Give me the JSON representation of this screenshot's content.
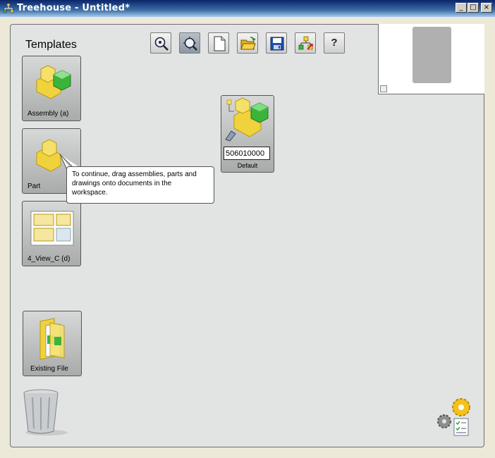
{
  "window": {
    "title": "Treehouse - Untitled*",
    "controls": {
      "minimize": "_",
      "maximize": "□",
      "close": "×"
    }
  },
  "templates": {
    "title": "Templates",
    "items": [
      {
        "label": "Assembly  (a)",
        "icon": "assembly-icon"
      },
      {
        "label": "Part",
        "icon": "part-icon"
      },
      {
        "label": "4_View_C  (d)",
        "icon": "drawing-icon"
      }
    ],
    "existing_file": {
      "label": "Existing File",
      "icon": "folder-icon"
    }
  },
  "toolbar": {
    "buttons": [
      {
        "name": "zoom-in",
        "icon": "magnifier-icon"
      },
      {
        "name": "zoom-fit",
        "icon": "zoom-fit-icon",
        "active": true
      },
      {
        "name": "new",
        "icon": "new-document-icon"
      },
      {
        "name": "open",
        "icon": "open-folder-icon"
      },
      {
        "name": "save",
        "icon": "floppy-disk-icon"
      },
      {
        "name": "export",
        "icon": "export-icon"
      },
      {
        "name": "help",
        "icon": "question-icon",
        "text": "?"
      }
    ]
  },
  "document": {
    "name_value": "506010000",
    "label": "Default",
    "icon": "assembly-icon"
  },
  "tooltip": {
    "text": "To continue, drag assemblies, parts and drawings onto documents in the workspace."
  },
  "colors": {
    "workspace": "#e2e4e4",
    "accent_yellow": "#f0d23c",
    "accent_green": "#3cb43c"
  }
}
